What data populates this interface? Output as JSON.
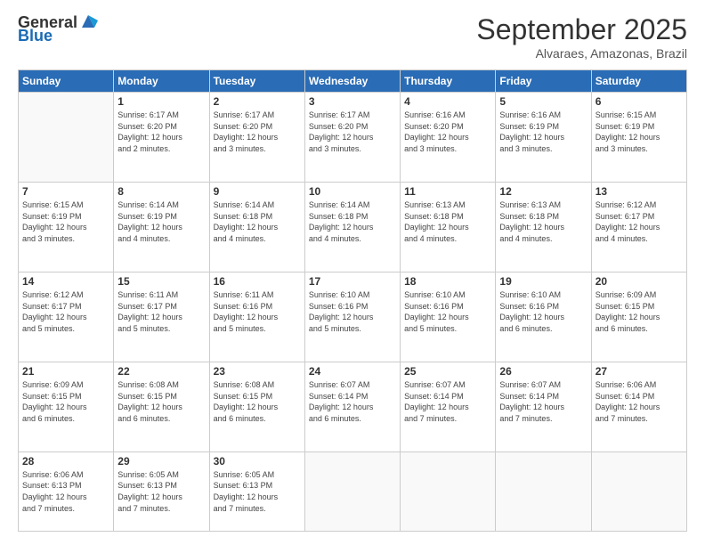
{
  "logo": {
    "general": "General",
    "blue": "Blue"
  },
  "title": "September 2025",
  "subtitle": "Alvaraes, Amazonas, Brazil",
  "days_of_week": [
    "Sunday",
    "Monday",
    "Tuesday",
    "Wednesday",
    "Thursday",
    "Friday",
    "Saturday"
  ],
  "weeks": [
    [
      {
        "day": "",
        "info": ""
      },
      {
        "day": "1",
        "info": "Sunrise: 6:17 AM\nSunset: 6:20 PM\nDaylight: 12 hours\nand 2 minutes."
      },
      {
        "day": "2",
        "info": "Sunrise: 6:17 AM\nSunset: 6:20 PM\nDaylight: 12 hours\nand 3 minutes."
      },
      {
        "day": "3",
        "info": "Sunrise: 6:17 AM\nSunset: 6:20 PM\nDaylight: 12 hours\nand 3 minutes."
      },
      {
        "day": "4",
        "info": "Sunrise: 6:16 AM\nSunset: 6:20 PM\nDaylight: 12 hours\nand 3 minutes."
      },
      {
        "day": "5",
        "info": "Sunrise: 6:16 AM\nSunset: 6:19 PM\nDaylight: 12 hours\nand 3 minutes."
      },
      {
        "day": "6",
        "info": "Sunrise: 6:15 AM\nSunset: 6:19 PM\nDaylight: 12 hours\nand 3 minutes."
      }
    ],
    [
      {
        "day": "7",
        "info": "Sunrise: 6:15 AM\nSunset: 6:19 PM\nDaylight: 12 hours\nand 3 minutes."
      },
      {
        "day": "8",
        "info": "Sunrise: 6:14 AM\nSunset: 6:19 PM\nDaylight: 12 hours\nand 4 minutes."
      },
      {
        "day": "9",
        "info": "Sunrise: 6:14 AM\nSunset: 6:18 PM\nDaylight: 12 hours\nand 4 minutes."
      },
      {
        "day": "10",
        "info": "Sunrise: 6:14 AM\nSunset: 6:18 PM\nDaylight: 12 hours\nand 4 minutes."
      },
      {
        "day": "11",
        "info": "Sunrise: 6:13 AM\nSunset: 6:18 PM\nDaylight: 12 hours\nand 4 minutes."
      },
      {
        "day": "12",
        "info": "Sunrise: 6:13 AM\nSunset: 6:18 PM\nDaylight: 12 hours\nand 4 minutes."
      },
      {
        "day": "13",
        "info": "Sunrise: 6:12 AM\nSunset: 6:17 PM\nDaylight: 12 hours\nand 4 minutes."
      }
    ],
    [
      {
        "day": "14",
        "info": "Sunrise: 6:12 AM\nSunset: 6:17 PM\nDaylight: 12 hours\nand 5 minutes."
      },
      {
        "day": "15",
        "info": "Sunrise: 6:11 AM\nSunset: 6:17 PM\nDaylight: 12 hours\nand 5 minutes."
      },
      {
        "day": "16",
        "info": "Sunrise: 6:11 AM\nSunset: 6:16 PM\nDaylight: 12 hours\nand 5 minutes."
      },
      {
        "day": "17",
        "info": "Sunrise: 6:10 AM\nSunset: 6:16 PM\nDaylight: 12 hours\nand 5 minutes."
      },
      {
        "day": "18",
        "info": "Sunrise: 6:10 AM\nSunset: 6:16 PM\nDaylight: 12 hours\nand 5 minutes."
      },
      {
        "day": "19",
        "info": "Sunrise: 6:10 AM\nSunset: 6:16 PM\nDaylight: 12 hours\nand 6 minutes."
      },
      {
        "day": "20",
        "info": "Sunrise: 6:09 AM\nSunset: 6:15 PM\nDaylight: 12 hours\nand 6 minutes."
      }
    ],
    [
      {
        "day": "21",
        "info": "Sunrise: 6:09 AM\nSunset: 6:15 PM\nDaylight: 12 hours\nand 6 minutes."
      },
      {
        "day": "22",
        "info": "Sunrise: 6:08 AM\nSunset: 6:15 PM\nDaylight: 12 hours\nand 6 minutes."
      },
      {
        "day": "23",
        "info": "Sunrise: 6:08 AM\nSunset: 6:15 PM\nDaylight: 12 hours\nand 6 minutes."
      },
      {
        "day": "24",
        "info": "Sunrise: 6:07 AM\nSunset: 6:14 PM\nDaylight: 12 hours\nand 6 minutes."
      },
      {
        "day": "25",
        "info": "Sunrise: 6:07 AM\nSunset: 6:14 PM\nDaylight: 12 hours\nand 7 minutes."
      },
      {
        "day": "26",
        "info": "Sunrise: 6:07 AM\nSunset: 6:14 PM\nDaylight: 12 hours\nand 7 minutes."
      },
      {
        "day": "27",
        "info": "Sunrise: 6:06 AM\nSunset: 6:14 PM\nDaylight: 12 hours\nand 7 minutes."
      }
    ],
    [
      {
        "day": "28",
        "info": "Sunrise: 6:06 AM\nSunset: 6:13 PM\nDaylight: 12 hours\nand 7 minutes."
      },
      {
        "day": "29",
        "info": "Sunrise: 6:05 AM\nSunset: 6:13 PM\nDaylight: 12 hours\nand 7 minutes."
      },
      {
        "day": "30",
        "info": "Sunrise: 6:05 AM\nSunset: 6:13 PM\nDaylight: 12 hours\nand 7 minutes."
      },
      {
        "day": "",
        "info": ""
      },
      {
        "day": "",
        "info": ""
      },
      {
        "day": "",
        "info": ""
      },
      {
        "day": "",
        "info": ""
      }
    ]
  ]
}
